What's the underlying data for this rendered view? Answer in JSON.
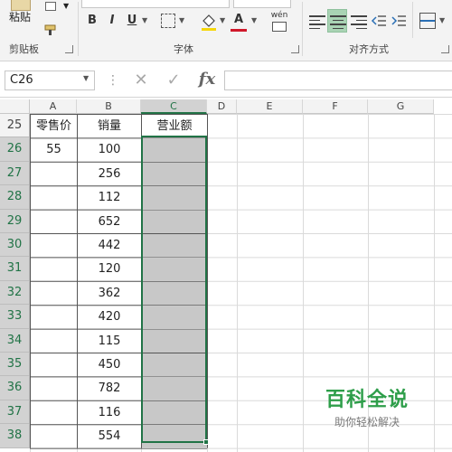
{
  "ribbon": {
    "paste_label": "粘贴",
    "clipboard_label": "剪贴板",
    "font_group_label": "字体",
    "align_group_label": "对齐方式",
    "bold_label": "B",
    "italic_label": "I",
    "underline_label": "U",
    "font_color_label": "A",
    "phonetic_label": "wén"
  },
  "formula_bar": {
    "name_box": "C26",
    "cancel_label": "✕",
    "confirm_label": "✓",
    "fx_label": "fx",
    "formula": ""
  },
  "sheet": {
    "columns": [
      "A",
      "B",
      "C",
      "D",
      "E",
      "F",
      "G"
    ],
    "selected_column": "C",
    "rows": [
      {
        "num": "25",
        "a": "零售价",
        "b": "销量",
        "c": "营业额"
      },
      {
        "num": "26",
        "a": "55",
        "b": "100",
        "c": ""
      },
      {
        "num": "27",
        "a": "",
        "b": "256",
        "c": ""
      },
      {
        "num": "28",
        "a": "",
        "b": "112",
        "c": ""
      },
      {
        "num": "29",
        "a": "",
        "b": "652",
        "c": ""
      },
      {
        "num": "30",
        "a": "",
        "b": "442",
        "c": ""
      },
      {
        "num": "31",
        "a": "",
        "b": "120",
        "c": ""
      },
      {
        "num": "32",
        "a": "",
        "b": "362",
        "c": ""
      },
      {
        "num": "33",
        "a": "",
        "b": "420",
        "c": ""
      },
      {
        "num": "34",
        "a": "",
        "b": "115",
        "c": ""
      },
      {
        "num": "35",
        "a": "",
        "b": "450",
        "c": ""
      },
      {
        "num": "36",
        "a": "",
        "b": "782",
        "c": ""
      },
      {
        "num": "37",
        "a": "",
        "b": "116",
        "c": ""
      },
      {
        "num": "38",
        "a": "",
        "b": "554",
        "c": ""
      }
    ]
  },
  "watermark": {
    "title": "百科全说",
    "subtitle": "助你轻松解决"
  },
  "colors": {
    "accent": "#217346",
    "selection_fill": "#c8c8c8",
    "watermark": "#2e9e4a"
  }
}
